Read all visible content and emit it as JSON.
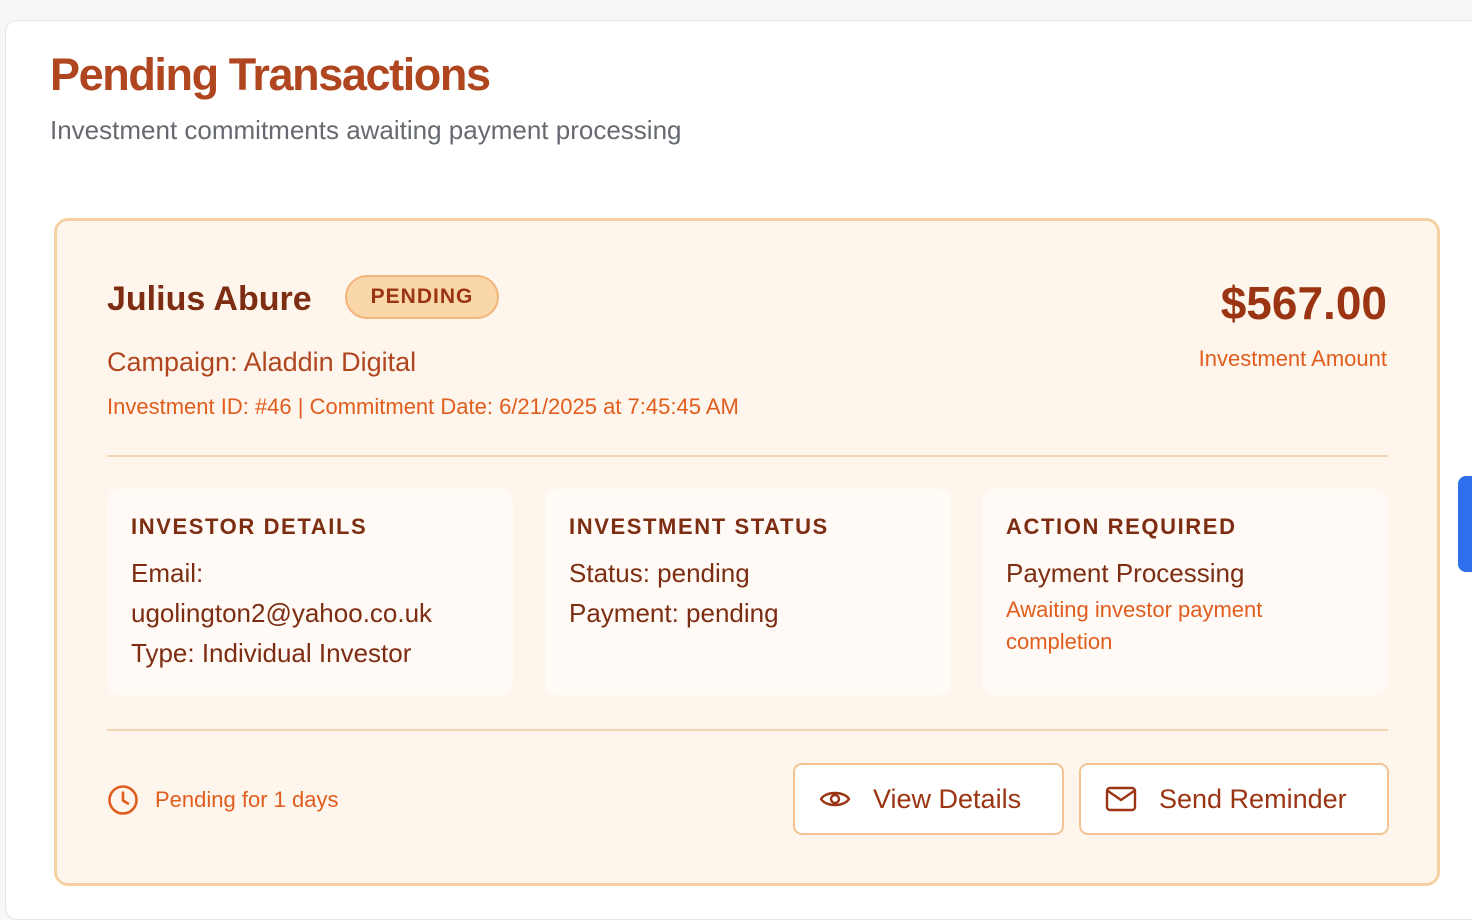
{
  "header": {
    "title": "Pending Transactions",
    "subtitle": "Investment commitments awaiting payment processing"
  },
  "transaction": {
    "investor_name": "Julius Abure",
    "status_badge": "PENDING",
    "campaign": "Campaign: Aladdin Digital",
    "meta": "Investment ID: #46 | Commitment Date: 6/21/2025 at 7:45:45 AM",
    "amount": "$567.00",
    "amount_label": "Investment Amount",
    "investor_details": {
      "heading": "INVESTOR DETAILS",
      "email_label": "Email:",
      "email": "ugolington2@yahoo.co.uk",
      "type": "Type: Individual Investor"
    },
    "investment_status": {
      "heading": "INVESTMENT STATUS",
      "status": "Status: pending",
      "payment": "Payment: pending"
    },
    "action_required": {
      "heading": "ACTION REQUIRED",
      "action": "Payment Processing",
      "note": "Awaiting investor payment completion"
    },
    "pending_age": "Pending for 1 days",
    "buttons": {
      "view_details": "View Details",
      "send_reminder": "Send Reminder"
    }
  },
  "icons": {
    "clock": "clock-icon",
    "eye": "eye-icon",
    "mail": "mail-icon"
  },
  "colors": {
    "title": "#b0461f",
    "accent": "#e05d1e",
    "dark_text": "#7c2d12",
    "card_background": "#fef6ec",
    "card_border": "#f6d2a3",
    "badge_background": "#fad7a8",
    "side_tab": "#2f6fee"
  }
}
